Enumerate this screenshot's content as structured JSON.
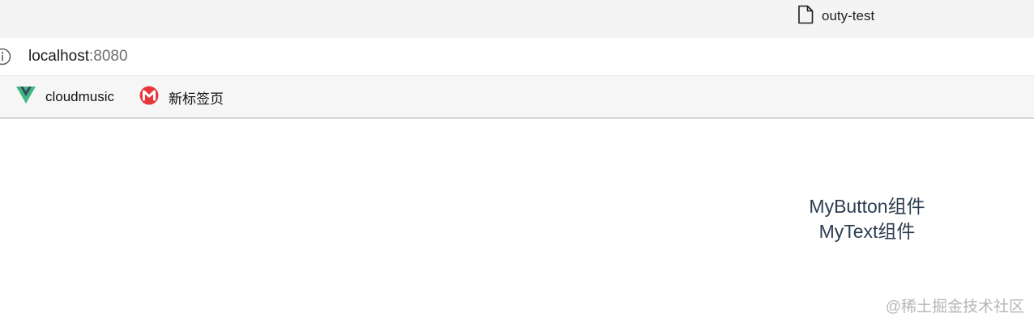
{
  "tab": {
    "title": "outy-test",
    "icon": "document-icon"
  },
  "address_bar": {
    "host": "localhost",
    "port": ":8080",
    "icon": "info-icon"
  },
  "bookmarks": [
    {
      "label": "cloudmusic",
      "icon": "vue-logo-icon",
      "color": "#41b883"
    },
    {
      "label": "新标签页",
      "icon": "red-m-logo-icon",
      "color": "#e8373a"
    }
  ],
  "page": {
    "components": [
      "MyButton组件",
      "MyText组件"
    ],
    "text_color": "#2c3e50"
  },
  "watermark": "@稀土掘金技术社区"
}
